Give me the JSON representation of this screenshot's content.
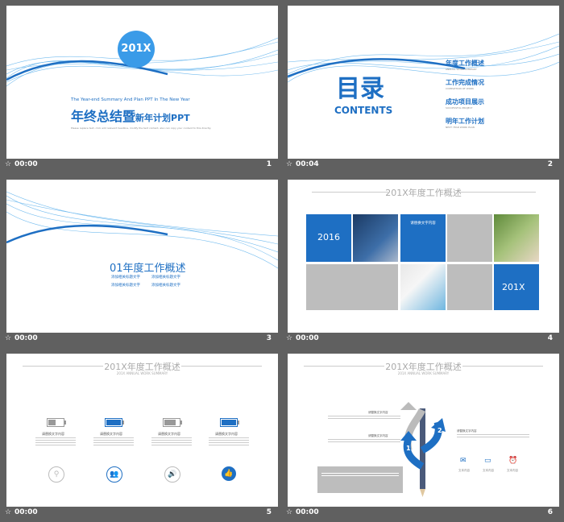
{
  "slides": [
    {
      "num": "1",
      "time": "00:00",
      "badge": "201X",
      "subtitle_en": "The Year-end Summary And Plan PPT In The New Year",
      "title_big": "年终总结暨",
      "title_small": "新年计划PPT",
      "desc": "Please replace text, click add relevant headline, modify the text content, also can copy your content to this directly."
    },
    {
      "num": "2",
      "time": "00:04",
      "title": "目录",
      "title_en": "CONTENTS",
      "items": [
        {
          "cn": "年度工作概述",
          "en": "ANNUAL WORK SUMMARY"
        },
        {
          "cn": "工作完成情况",
          "en": "COMPLETION OF WORK"
        },
        {
          "cn": "成功项目展示",
          "en": "SUCCESSFUL PROJECT"
        },
        {
          "cn": "明年工作计划",
          "en": "NEXT YEAR WORK PLAN"
        }
      ]
    },
    {
      "num": "3",
      "time": "00:00",
      "title": "01年度工作概述",
      "bullets": [
        "添加相关标题文字",
        "添加相关标题文字",
        "添加相关标题文字",
        "添加相关标题文字"
      ]
    },
    {
      "num": "4",
      "time": "00:00",
      "header": "201X年度工作概述",
      "year1": "2016",
      "year2": "201X",
      "box_title": "请替换文字内容"
    },
    {
      "num": "5",
      "time": "00:00",
      "header": "201X年度工作概述",
      "header_en": "201X ANNUAL WORK SUMMARY",
      "cols": [
        {
          "label": "请替换文字内容",
          "fill": 0.5,
          "color": "#999999",
          "icon": "search-icon"
        },
        {
          "label": "请替换文字内容",
          "fill": 1.0,
          "color": "#1e6fc3",
          "icon": "users-icon"
        },
        {
          "label": "请替换文字内容",
          "fill": 0.75,
          "color": "#999999",
          "icon": "speaker-icon"
        },
        {
          "label": "请替换文字内容",
          "fill": 1.0,
          "color": "#1e6fc3",
          "icon": "thumbs-up-icon"
        }
      ]
    },
    {
      "num": "6",
      "time": "00:00",
      "header": "201X年度工作概述",
      "header_en": "201X ANNUAL WORK SUMMARY",
      "arrows": [
        "1",
        "2",
        "3"
      ],
      "label": "请替换文字内容",
      "icons": [
        {
          "name": "mail-icon",
          "label": "文本内容"
        },
        {
          "name": "tv-icon",
          "label": "文本内容"
        },
        {
          "name": "alarm-icon",
          "label": "文本内容"
        }
      ]
    }
  ],
  "colors": {
    "accent": "#1e6fc3",
    "frame": "#606060",
    "gray": "#b3b3b3"
  }
}
